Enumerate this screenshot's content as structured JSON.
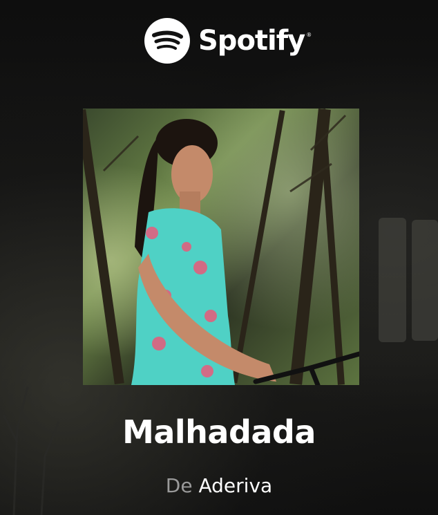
{
  "brand": {
    "name": "Spotify",
    "registered_mark": "®",
    "icon": "spotify-logo-icon"
  },
  "track": {
    "title": "Malhadada",
    "by_label": "De",
    "artist": "Aderiva"
  },
  "cover_art": {
    "description_icon": "album-cover-image"
  },
  "colors": {
    "background": "#121212",
    "text_primary": "#ffffff",
    "text_secondary": "#9a9a9a"
  }
}
